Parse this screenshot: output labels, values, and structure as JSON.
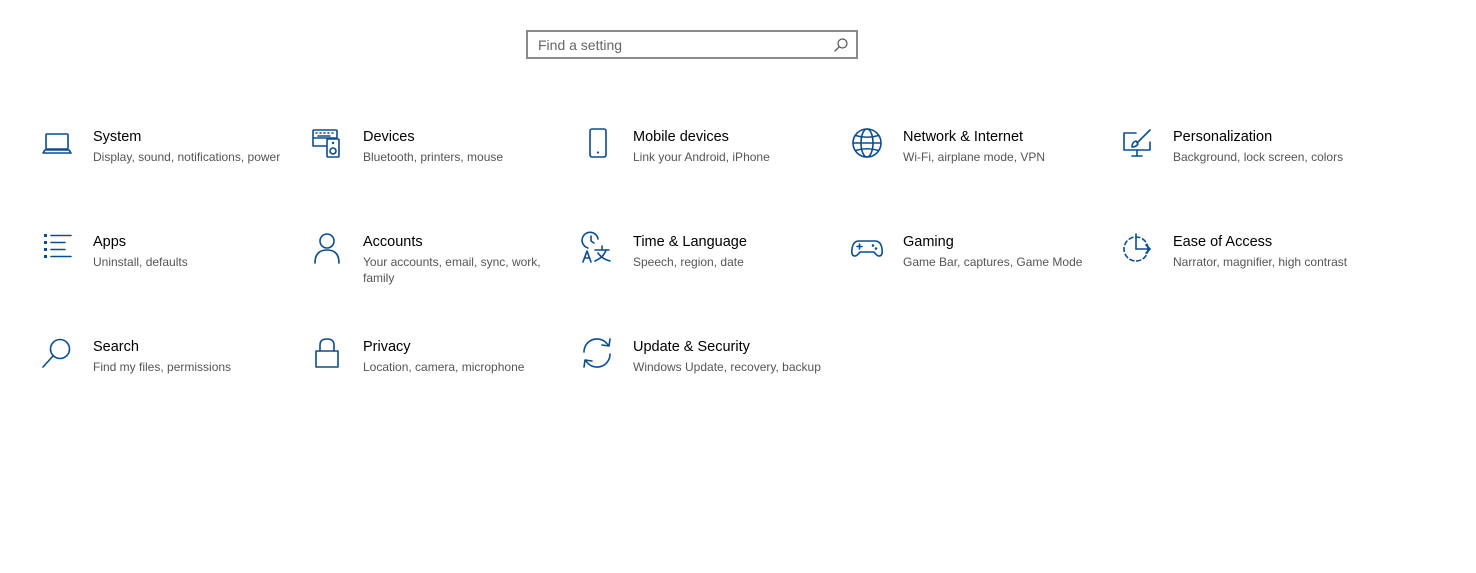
{
  "search": {
    "placeholder": "Find a setting",
    "icon": "search-icon"
  },
  "theme": {
    "accent": "#0b4d8c",
    "title_color": "#000000",
    "desc_color": "#555555"
  },
  "tiles": [
    {
      "id": "system",
      "icon": "laptop-icon",
      "title": "System",
      "desc": "Display, sound, notifications, power"
    },
    {
      "id": "devices",
      "icon": "keyboard-speaker-icon",
      "title": "Devices",
      "desc": "Bluetooth, printers, mouse"
    },
    {
      "id": "mobile",
      "icon": "phone-icon",
      "title": "Mobile devices",
      "desc": "Link your Android, iPhone"
    },
    {
      "id": "network",
      "icon": "globe-icon",
      "title": "Network & Internet",
      "desc": "Wi-Fi, airplane mode, VPN"
    },
    {
      "id": "personalization",
      "icon": "paintbrush-monitor-icon",
      "title": "Personalization",
      "desc": "Background, lock screen, colors"
    },
    {
      "id": "apps",
      "icon": "apps-list-icon",
      "title": "Apps",
      "desc": "Uninstall, defaults"
    },
    {
      "id": "accounts",
      "icon": "person-icon",
      "title": "Accounts",
      "desc": "Your accounts, email, sync, work, family"
    },
    {
      "id": "time",
      "icon": "clock-language-icon",
      "title": "Time & Language",
      "desc": "Speech, region, date"
    },
    {
      "id": "gaming",
      "icon": "gamepad-icon",
      "title": "Gaming",
      "desc": "Game Bar, captures, Game Mode"
    },
    {
      "id": "ease",
      "icon": "ease-of-access-icon",
      "title": "Ease of Access",
      "desc": "Narrator, magnifier, high contrast"
    },
    {
      "id": "search",
      "icon": "magnifier-icon",
      "title": "Search",
      "desc": "Find my files, permissions"
    },
    {
      "id": "privacy",
      "icon": "padlock-icon",
      "title": "Privacy",
      "desc": "Location, camera, microphone"
    },
    {
      "id": "update",
      "icon": "refresh-arrows-icon",
      "title": "Update & Security",
      "desc": "Windows Update, recovery, backup"
    }
  ]
}
